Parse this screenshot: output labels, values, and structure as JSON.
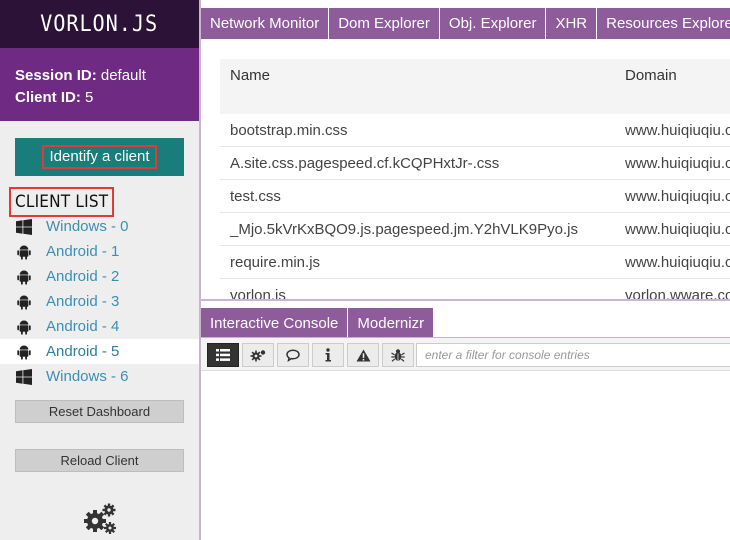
{
  "app": {
    "logo": "VORLON.JS"
  },
  "session": {
    "session_label": "Session ID:",
    "session_value": "default",
    "client_label": "Client ID:",
    "client_value": "5"
  },
  "sidebar": {
    "identify_label": "Identify a client",
    "client_list_title": "CLIENT LIST",
    "clients": [
      {
        "label": "Windows - 0",
        "icon": "windows-icon"
      },
      {
        "label": "Android - 1",
        "icon": "android-icon"
      },
      {
        "label": "Android - 2",
        "icon": "android-icon"
      },
      {
        "label": "Android - 3",
        "icon": "android-icon"
      },
      {
        "label": "Android - 4",
        "icon": "android-icon"
      },
      {
        "label": "Android - 5",
        "icon": "android-icon",
        "selected": true
      },
      {
        "label": "Windows - 6",
        "icon": "windows-icon"
      }
    ],
    "reset_label": "Reset Dashboard",
    "reload_label": "Reload Client",
    "settings_icon": "gears-icon"
  },
  "top_tabs": [
    "Network Monitor",
    "Dom Explorer",
    "Obj. Explorer",
    "XHR",
    "Resources Explorer"
  ],
  "resources": {
    "columns": [
      "Name",
      "Domain"
    ],
    "rows": [
      {
        "name": "bootstrap.min.css",
        "domain": "www.huiqiuqiu.com"
      },
      {
        "name": "A.site.css.pagespeed.cf.kCQPHxtJr-.css",
        "domain": "www.huiqiuqiu.com"
      },
      {
        "name": "test.css",
        "domain": "www.huiqiuqiu.com"
      },
      {
        "name": "_Mjo.5kVrKxBQO9.js.pagespeed.jm.Y2hVLK9Pyo.js",
        "domain": "www.huiqiuqiu.com"
      },
      {
        "name": "require.min.js",
        "domain": "www.huiqiuqiu.com"
      },
      {
        "name": "vorlon.js",
        "domain": "vorlon.wware.com"
      }
    ]
  },
  "bottom_tabs": [
    "Interactive Console",
    "Modernizr"
  ],
  "console": {
    "filter_placeholder": "enter a filter for console entries",
    "toolbar_icons": [
      "list-icon",
      "settings-icon",
      "chat-icon",
      "info-icon",
      "warning-icon",
      "bug-icon"
    ]
  },
  "colors": {
    "logo_bg": "#2b1236",
    "session_bg": "#6f2b83",
    "tab_bg": "#8e5b9b",
    "identify_bg": "#187d7b",
    "link": "#3a8fb5",
    "highlight_box": "#e53935"
  }
}
